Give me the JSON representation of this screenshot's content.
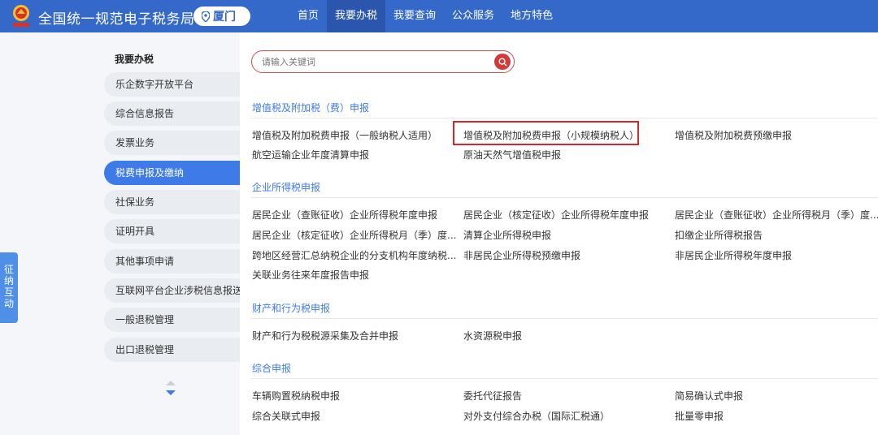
{
  "header": {
    "title": "全国统一规范电子税务局",
    "city": "厦门",
    "nav": [
      "首页",
      "我要办税",
      "我要查询",
      "公众服务",
      "地方特色"
    ],
    "active_nav": 1
  },
  "sidebar": {
    "title": "我要办税",
    "items": [
      "乐企数字开放平台",
      "综合信息报告",
      "发票业务",
      "税费申报及缴纳",
      "社保业务",
      "证明开具",
      "其他事项申请",
      "互联网平台企业涉税信息报送",
      "一般退税管理",
      "出口退税管理"
    ],
    "active_item": 3
  },
  "float_tab": [
    "征",
    "纳",
    "互",
    "动"
  ],
  "search": {
    "placeholder": "请输入关键词"
  },
  "sections": [
    {
      "title": "增值税及附加税（费）申报",
      "links": [
        "增值税及附加税费申报（一般纳税人适用）",
        "增值税及附加税费申报（小规模纳税人）",
        "增值税及附加税费预缴申报",
        "航空运输企业年度清算申报",
        "原油天然气增值税申报"
      ]
    },
    {
      "title": "企业所得税申报",
      "links": [
        "居民企业（查账征收）企业所得税年度申报",
        "居民企业（核定征收）企业所得税年度申报",
        "居民企业（查账征收）企业所得税月（季）度...",
        "居民企业（核定征收）企业所得税月（季）度...",
        "清算企业所得税申报",
        "扣缴企业所得税报告",
        "跨地区经营汇总纳税企业的分支机构年度纳税...",
        "非居民企业所得税预缴申报",
        "非居民企业所得税年度申报",
        "关联业务往来年度报告申报"
      ]
    },
    {
      "title": "财产和行为税申报",
      "links": [
        "财产和行为税税源采集及合并申报",
        "水资源税申报"
      ]
    },
    {
      "title": "综合申报",
      "links": [
        "车辆购置税纳税申报",
        "委托代征报告",
        "简易确认式申报",
        "综合关联式申报",
        "对外支付综合办税（国际汇税通）",
        "批量零申报"
      ]
    }
  ],
  "highlighted_link": "增值税及附加税费申报（小规模纳税人）",
  "colors": {
    "header": "#3569c9",
    "accent": "#3e7ae8",
    "highlight_border": "#d8262b",
    "search_border": "#d94a4a"
  }
}
